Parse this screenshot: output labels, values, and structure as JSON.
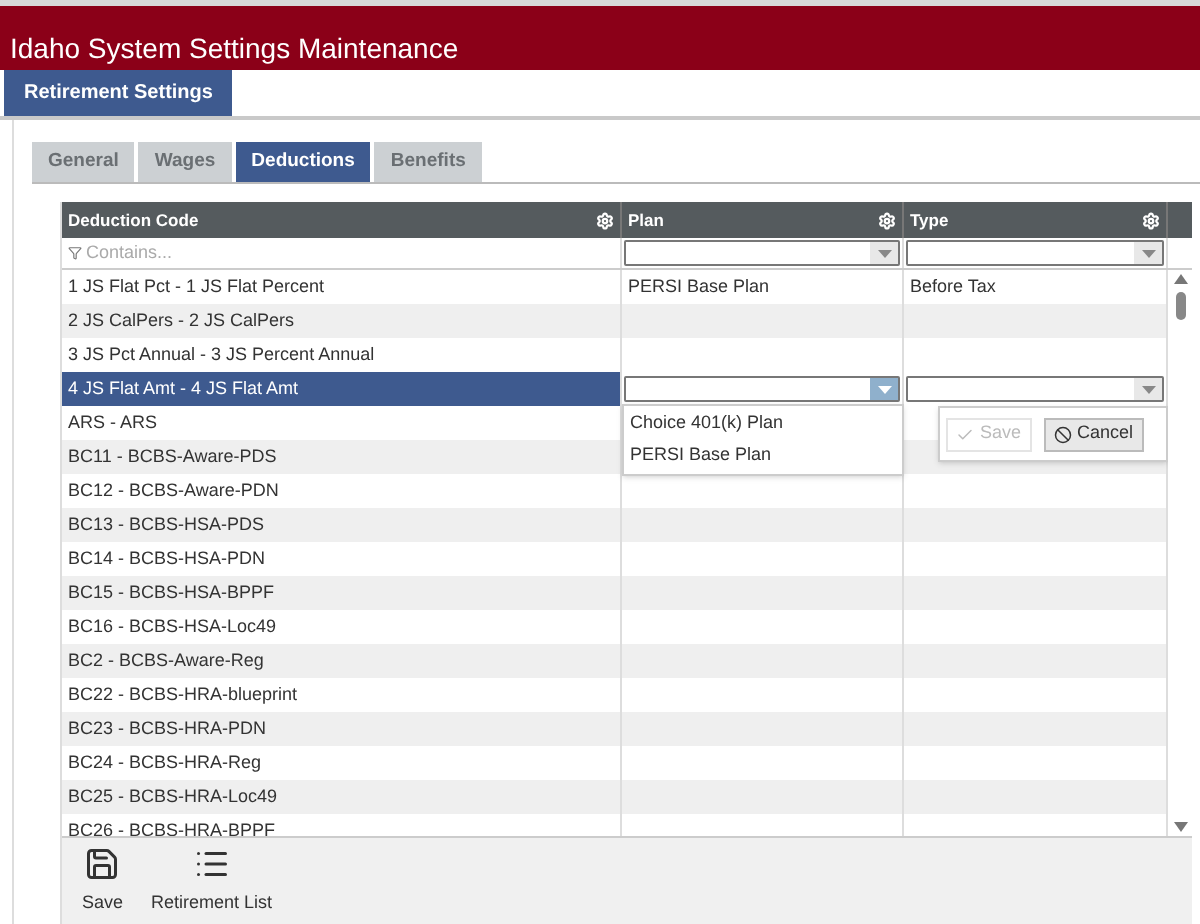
{
  "header": {
    "title": "Idaho System Settings Maintenance"
  },
  "page_tabs": [
    {
      "label": "Retirement Settings",
      "selected": true
    }
  ],
  "tabs": [
    {
      "label": "General",
      "selected": false
    },
    {
      "label": "Wages",
      "selected": false
    },
    {
      "label": "Deductions",
      "selected": true
    },
    {
      "label": "Benefits",
      "selected": false
    }
  ],
  "grid": {
    "columns": [
      {
        "label": "Deduction Code",
        "kind": "text"
      },
      {
        "label": "Plan",
        "kind": "select"
      },
      {
        "label": "Type",
        "kind": "select"
      }
    ],
    "filter": {
      "placeholder": "Contains..."
    },
    "rows": [
      {
        "code": "1 JS Flat Pct - 1 JS Flat Percent",
        "plan": "PERSI Base Plan",
        "type": "Before Tax",
        "selected": false,
        "editing": false
      },
      {
        "code": "2 JS CalPers - 2 JS CalPers",
        "selected": false,
        "editing": false
      },
      {
        "code": "3 JS Pct Annual - 3 JS Percent Annual",
        "selected": false,
        "editing": false
      },
      {
        "code": "4 JS Flat Amt - 4 JS Flat Amt",
        "selected": true,
        "editing": true
      },
      {
        "code": "ARS - ARS",
        "selected": false,
        "editing": false
      },
      {
        "code": "BC11 - BCBS-Aware-PDS",
        "selected": false,
        "editing": false
      },
      {
        "code": "BC12 - BCBS-Aware-PDN",
        "selected": false,
        "editing": false
      },
      {
        "code": "BC13 - BCBS-HSA-PDS",
        "selected": false,
        "editing": false
      },
      {
        "code": "BC14 - BCBS-HSA-PDN",
        "selected": false,
        "editing": false
      },
      {
        "code": "BC15 - BCBS-HSA-BPPF",
        "selected": false,
        "editing": false
      },
      {
        "code": "BC16 - BCBS-HSA-Loc49",
        "selected": false,
        "editing": false
      },
      {
        "code": "BC2 - BCBS-Aware-Reg",
        "selected": false,
        "editing": false
      },
      {
        "code": "BC22 - BCBS-HRA-blueprint",
        "selected": false,
        "editing": false
      },
      {
        "code": "BC23 - BCBS-HRA-PDN",
        "selected": false,
        "editing": false
      },
      {
        "code": "BC24 - BCBS-HRA-Reg",
        "selected": false,
        "editing": false
      },
      {
        "code": "BC25 - BCBS-HRA-Loc49",
        "selected": false,
        "editing": false
      },
      {
        "code": "BC26 - BCBS-HRA-BPPF",
        "selected": false,
        "editing": false
      }
    ],
    "plan_dropdown": {
      "expanded": true,
      "options": [
        "Choice 401(k) Plan",
        "PERSI Base Plan"
      ]
    },
    "edit_popup": {
      "buttons": [
        {
          "label": "Save",
          "kind": "save",
          "disabled": true
        },
        {
          "label": "Cancel",
          "kind": "cancel",
          "disabled": false
        }
      ]
    }
  },
  "toolbar": [
    {
      "label": "Save",
      "kind": "save"
    },
    {
      "label": "Retirement List",
      "kind": "list"
    }
  ]
}
